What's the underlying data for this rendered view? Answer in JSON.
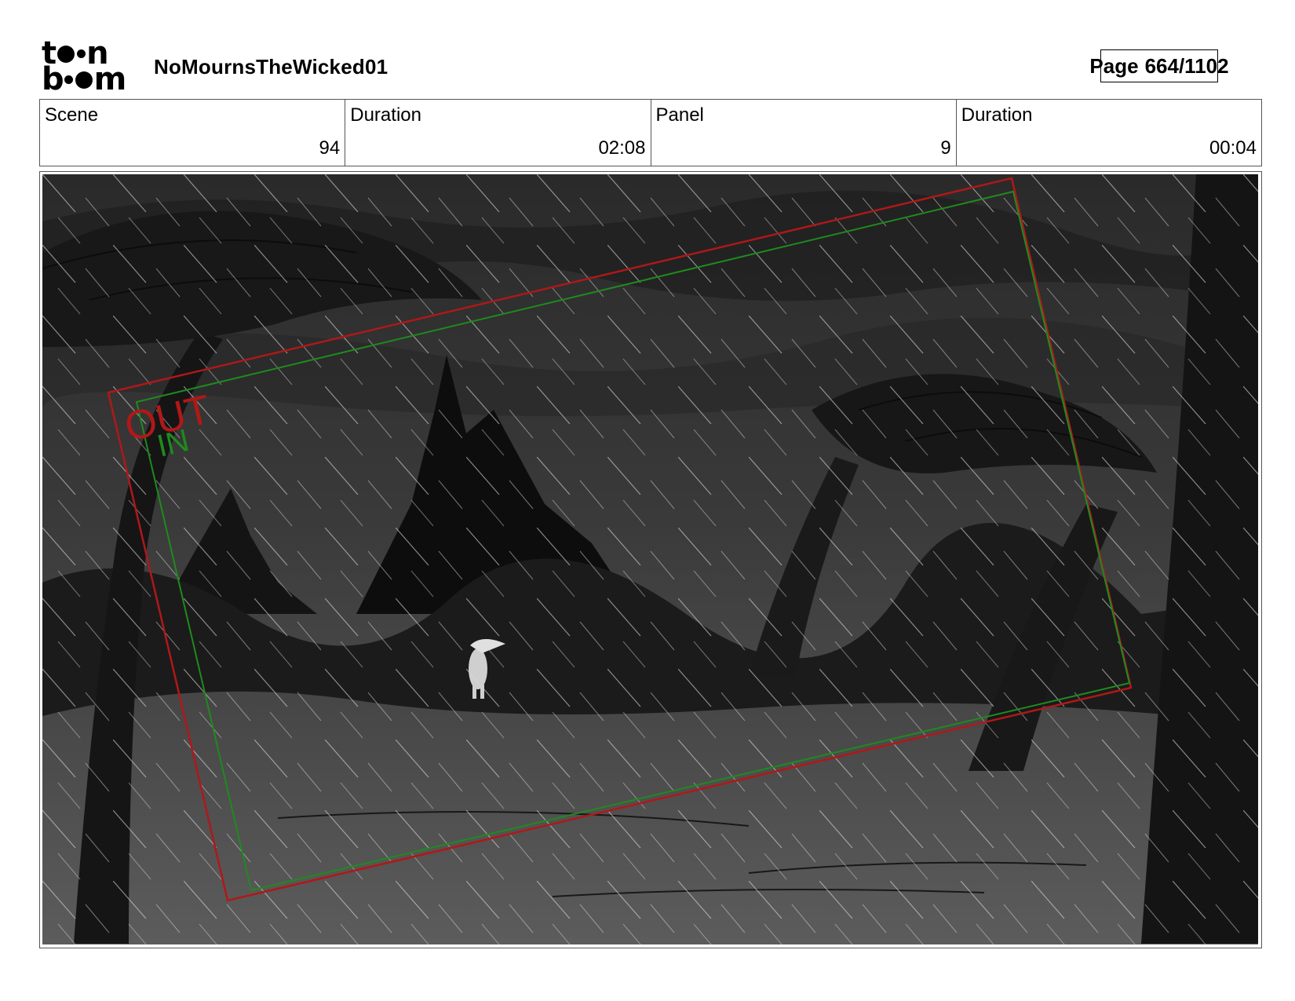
{
  "header": {
    "logo_line1_start": "t",
    "logo_line1_end": "n",
    "logo_line2_start": "b",
    "logo_line2_end": "m",
    "project_title": "NoMournsTheWicked01",
    "page_label": "Page",
    "page_value": "664/1102"
  },
  "info": {
    "scene_label": "Scene",
    "scene_value": "94",
    "scene_duration_label": "Duration",
    "scene_duration_value": "02:08",
    "panel_label": "Panel",
    "panel_value": "9",
    "panel_duration_label": "Duration",
    "panel_duration_value": "00:04"
  },
  "panel": {
    "out_label": "OUT",
    "in_label": "IN",
    "colors": {
      "out_frame": "#b01818",
      "in_frame": "#1f8a1f"
    }
  }
}
